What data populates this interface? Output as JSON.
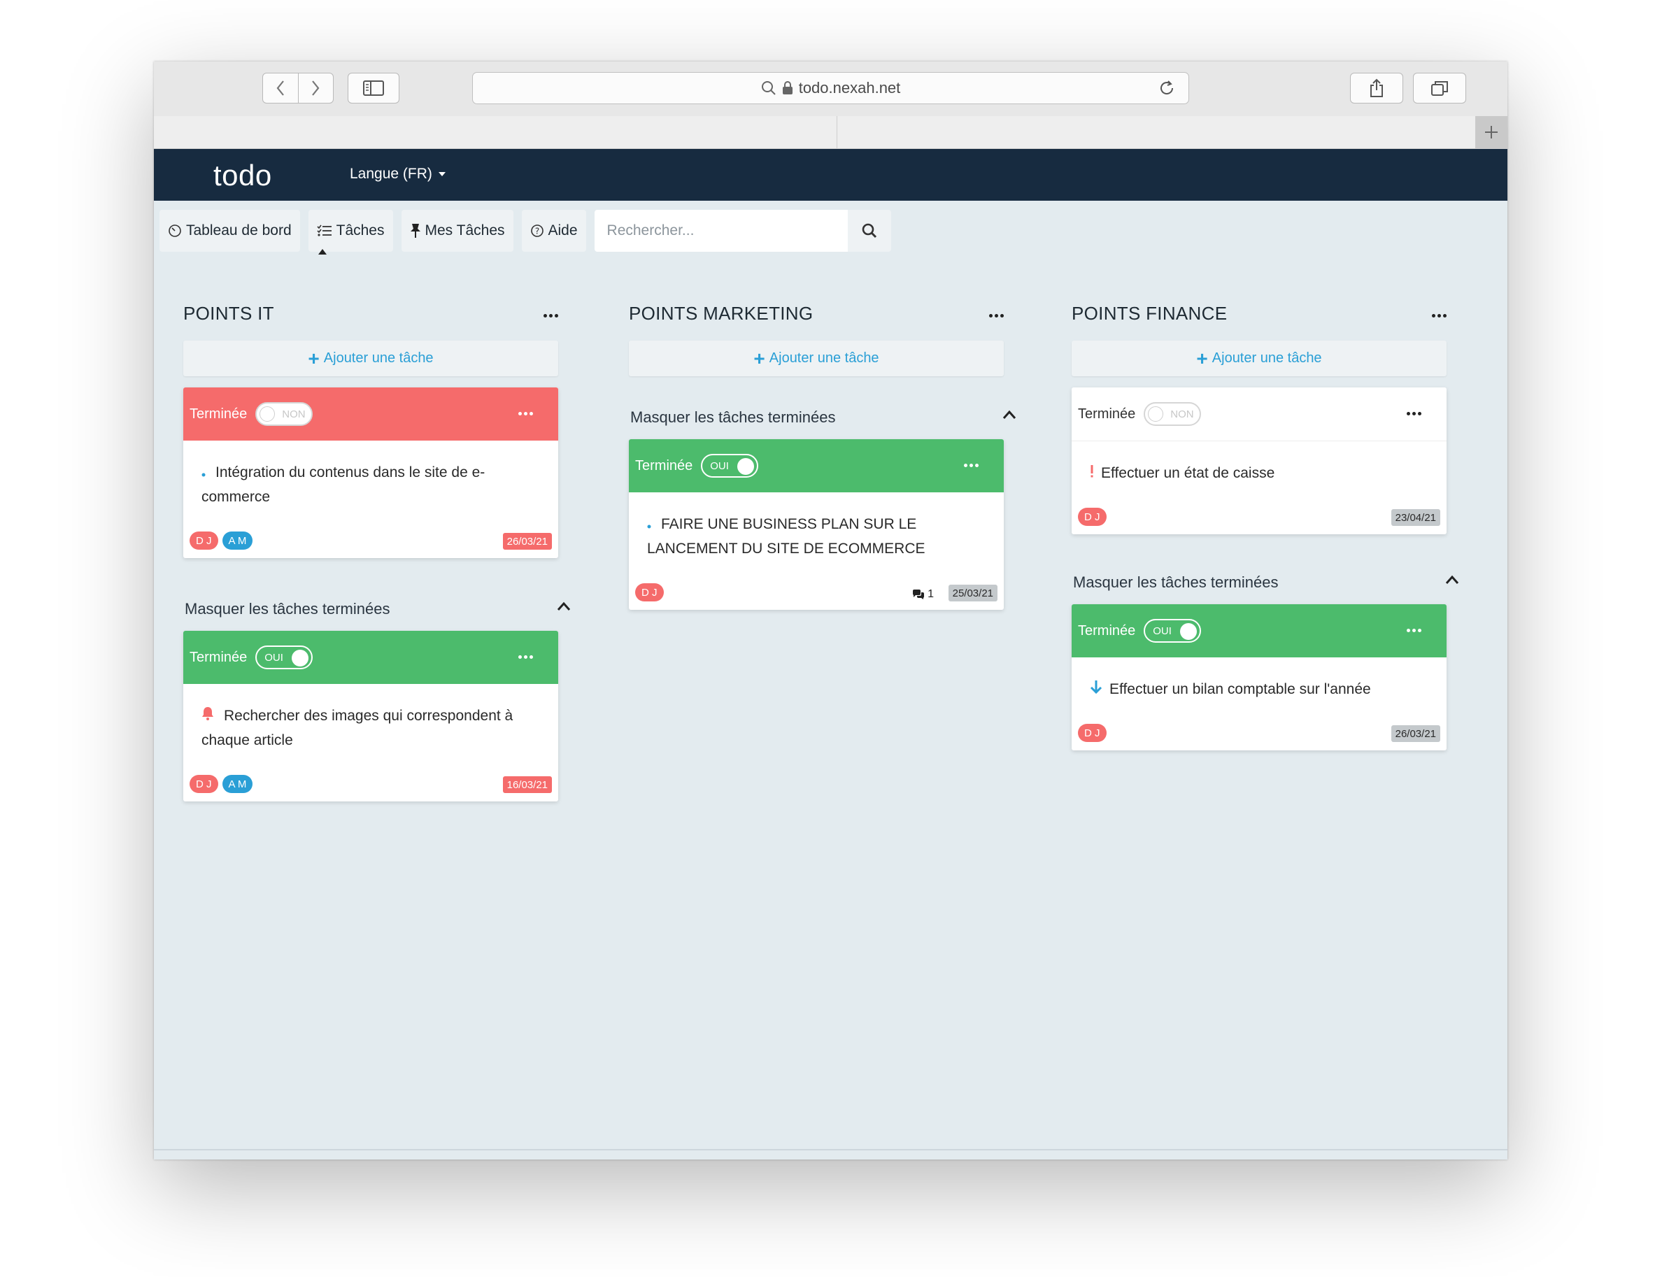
{
  "browser": {
    "url": "todo.nexah.net"
  },
  "app": {
    "brand": "todo",
    "language": "Langue (FR)"
  },
  "menu": {
    "dashboard": "Tableau de bord",
    "tasks": "Tâches",
    "my_tasks": "Mes Tâches",
    "help": "Aide",
    "search_placeholder": "Rechercher..."
  },
  "labels": {
    "add_task": "Ajouter une tâche",
    "hide_done": "Masquer les tâches terminées",
    "done": "Terminée",
    "yes": "OUI",
    "no": "NON"
  },
  "columns": [
    {
      "title": "POINTS IT",
      "open_tasks": [
        {
          "status": "NON",
          "text": "Intégration du contenus dans le site de e-commerce",
          "priority": "low-dot",
          "assignees": [
            "D J",
            "A M"
          ],
          "date": "26/03/21",
          "date_style": "overdue"
        }
      ],
      "done_tasks": [
        {
          "status": "OUI",
          "text": "Rechercher des images qui correspondent à chaque article",
          "priority": "bell-icon",
          "assignees": [
            "D J",
            "A M"
          ],
          "date": "16/03/21",
          "date_style": "overdue"
        }
      ]
    },
    {
      "title": "POINTS MARKETING",
      "open_tasks": [],
      "done_tasks": [
        {
          "status": "OUI",
          "text": "FAIRE UNE BUSINESS PLAN SUR LE LANCEMENT DU SITE DE ECOMMERCE",
          "priority": "low-dot",
          "assignees": [
            "D J"
          ],
          "comments": "1",
          "date": "25/03/21",
          "date_style": "normal"
        }
      ]
    },
    {
      "title": "POINTS FINANCE",
      "open_tasks": [
        {
          "status": "NON",
          "text": "Effectuer un état de caisse",
          "priority": "exclamation-icon",
          "assignees": [
            "D J"
          ],
          "date": "23/04/21",
          "date_style": "normal"
        }
      ],
      "done_tasks": [
        {
          "status": "OUI",
          "text": "Effectuer un bilan comptable sur l'année",
          "priority": "arrow-down-icon",
          "assignees": [
            "D J"
          ],
          "date": "26/03/21",
          "date_style": "normal"
        }
      ]
    }
  ],
  "colors": {
    "navbar": "#172b40",
    "done_green": "#4cbb6c",
    "overdue_red": "#f56b6b",
    "accent_blue": "#2a9fd6",
    "background": "#e3ebef"
  }
}
